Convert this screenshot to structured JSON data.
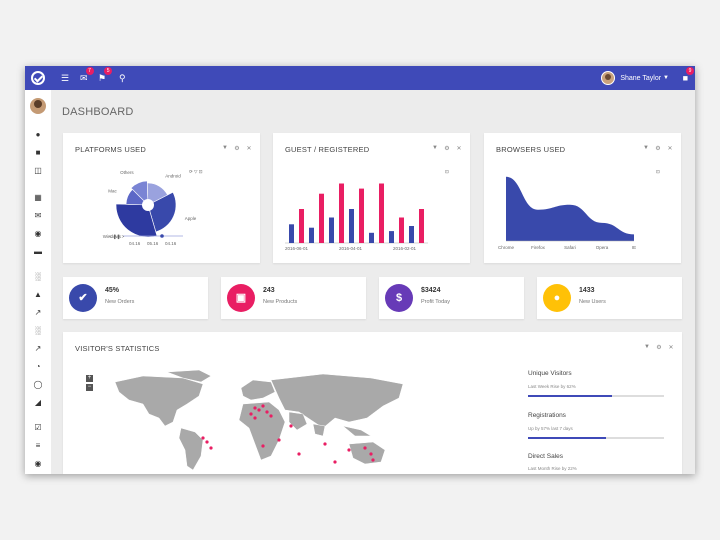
{
  "colors": {
    "accent": "#3f4ab8",
    "pink": "#e91e63",
    "purple": "#673ab7",
    "amber": "#ffc107",
    "navy": "#3949ab"
  },
  "topbar": {
    "icons": [
      "logo-check-icon",
      "menu-icon",
      "mail-icon",
      "bell-icon",
      "search-icon"
    ],
    "mail_badge": "7",
    "bell_badge": "5",
    "chat_badge": "9",
    "user_name": "Shane Taylor"
  },
  "sidebar": {
    "icons": [
      "dashboard-icon",
      "briefcase-icon",
      "columns-icon",
      "calendar-icon",
      "mail-icon",
      "chat-icon",
      "inbox-icon",
      "bar-chart-icon",
      "area-chart-icon",
      "line-chart-icon",
      "bar-chart-icon",
      "line-chart-icon",
      "pie-chart-icon",
      "donut-icon",
      "area-chart-icon",
      "checklist-icon",
      "sliders-icon",
      "settings-icon"
    ]
  },
  "page": {
    "title": "DASHBOARD"
  },
  "cards": {
    "platforms": {
      "title": "PLATFORMS USED"
    },
    "guest": {
      "title": "GUEST / REGISTERED"
    },
    "browsers": {
      "title": "BROWSERS USED"
    },
    "visitors": {
      "title": "VISITOR'S STATISTICS"
    }
  },
  "stats": [
    {
      "value": "45%",
      "label": "New Orders",
      "icon": "thumbs-up-icon",
      "color": "#3949ab"
    },
    {
      "value": "243",
      "label": "New Products",
      "icon": "cart-icon",
      "color": "#e91e63"
    },
    {
      "value": "$3424",
      "label": "Profit Today",
      "icon": "dollar-icon",
      "color": "#673ab7"
    },
    {
      "value": "1433",
      "label": "New Users",
      "icon": "users-icon",
      "color": "#ffc107"
    }
  ],
  "visitor_stats": [
    {
      "label": "Unique Visitors",
      "sub": "Last Week Rise by 62%",
      "progress": 0.62
    },
    {
      "label": "Registrations",
      "sub": "Up by 57% last 7 days",
      "progress": 0.57
    },
    {
      "label": "Direct Sales",
      "sub": "Last Month Rise by 22%",
      "progress": 0.22
    }
  ],
  "chart_data": [
    {
      "type": "pie",
      "title": "PLATFORMS USED",
      "categories": [
        "Others",
        "Android",
        "Apple",
        "Windows",
        "Mac"
      ],
      "values": [
        12,
        18,
        28,
        30,
        12
      ],
      "x_ticks": [
        "04.16",
        "05.16",
        "04.16"
      ]
    },
    {
      "type": "bar",
      "title": "GUEST / REGISTERED",
      "categories": [
        "2016-06-01",
        "",
        "",
        "",
        "",
        "",
        "2016-04-01",
        "",
        "",
        "",
        "",
        "",
        "2016-02-01",
        ""
      ],
      "series": [
        {
          "name": "",
          "color": "#3949ab",
          "values": [
            22,
            18,
            30,
            40,
            12,
            14,
            20
          ]
        },
        {
          "name": "",
          "color": "#e91e63",
          "values": [
            40,
            58,
            70,
            64,
            70,
            30,
            40
          ]
        }
      ],
      "ylim": [
        0,
        80
      ],
      "x_ticks": [
        "2016-06-01",
        "2016-04-01",
        "2016-02-01"
      ]
    },
    {
      "type": "area",
      "title": "BROWSERS USED",
      "categories": [
        "Chrome",
        "Firefox",
        "Safari",
        "Opera",
        "IE"
      ],
      "values": [
        78,
        38,
        44,
        22,
        8
      ],
      "ylim": [
        0,
        85
      ]
    }
  ]
}
